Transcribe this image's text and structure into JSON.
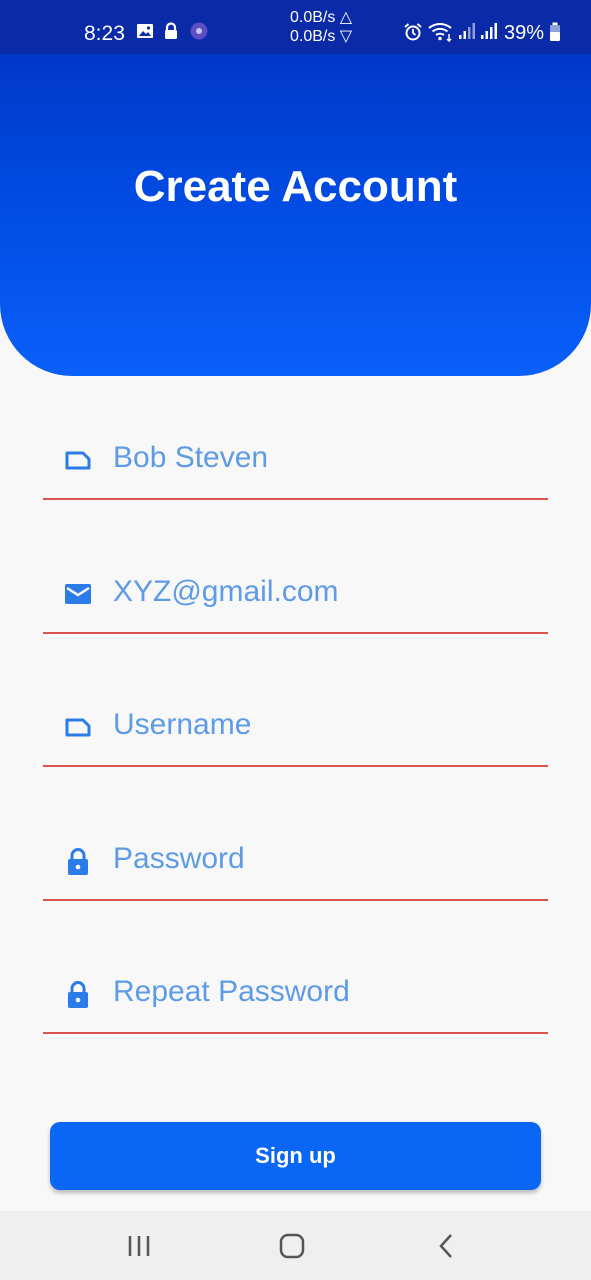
{
  "status_bar": {
    "time": "8:23",
    "net_up": "0.0B/s △",
    "net_down": "0.0B/s ▽",
    "battery": "39%"
  },
  "header": {
    "title": "Create Account"
  },
  "form": {
    "name": {
      "value": "Bob Steven",
      "icon": "label-icon"
    },
    "email": {
      "value": "XYZ@gmail.com",
      "icon": "mail-icon"
    },
    "username": {
      "placeholder": "Username",
      "icon": "label-icon"
    },
    "password": {
      "placeholder": "Password",
      "icon": "lock-icon"
    },
    "repeat_password": {
      "placeholder": "Repeat Password",
      "icon": "lock-icon"
    }
  },
  "signup_button": {
    "label": "Sign up"
  },
  "colors": {
    "accent": "#0a66f5",
    "header_top": "#0038c8",
    "field_text": "#5d9be6",
    "underline": "#d9534f"
  }
}
